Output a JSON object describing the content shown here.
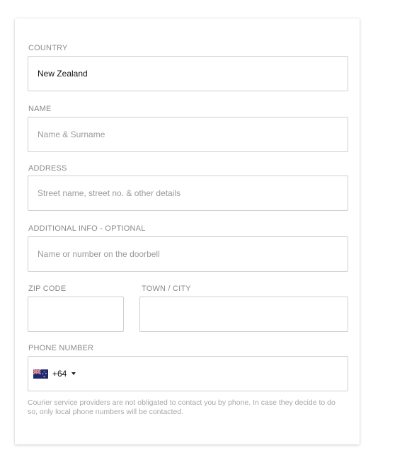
{
  "form": {
    "country": {
      "label": "COUNTRY",
      "value": "New Zealand"
    },
    "name": {
      "label": "NAME",
      "placeholder": "Name & Surname",
      "value": ""
    },
    "address": {
      "label": "ADDRESS",
      "placeholder": "Street name, street no. & other details",
      "value": ""
    },
    "additional_info": {
      "label": "ADDITIONAL INFO - OPTIONAL",
      "placeholder": "Name or number on the doorbell",
      "value": ""
    },
    "zip": {
      "label": "ZIP CODE",
      "placeholder": "",
      "value": ""
    },
    "town": {
      "label": "TOWN / CITY",
      "placeholder": "",
      "value": ""
    },
    "phone": {
      "label": "PHONE NUMBER",
      "flag_icon": "new-zealand-flag-icon",
      "dial_code": "+64",
      "value": ""
    },
    "phone_hint": "Courier service providers are not obligated to contact you by phone. In case they decide to do so, only local phone numbers will be contacted."
  },
  "colors": {
    "label": "#8a8a8a",
    "border": "#cfcfcf",
    "placeholder": "#9a9a9a",
    "hint": "#a8a8a8"
  }
}
